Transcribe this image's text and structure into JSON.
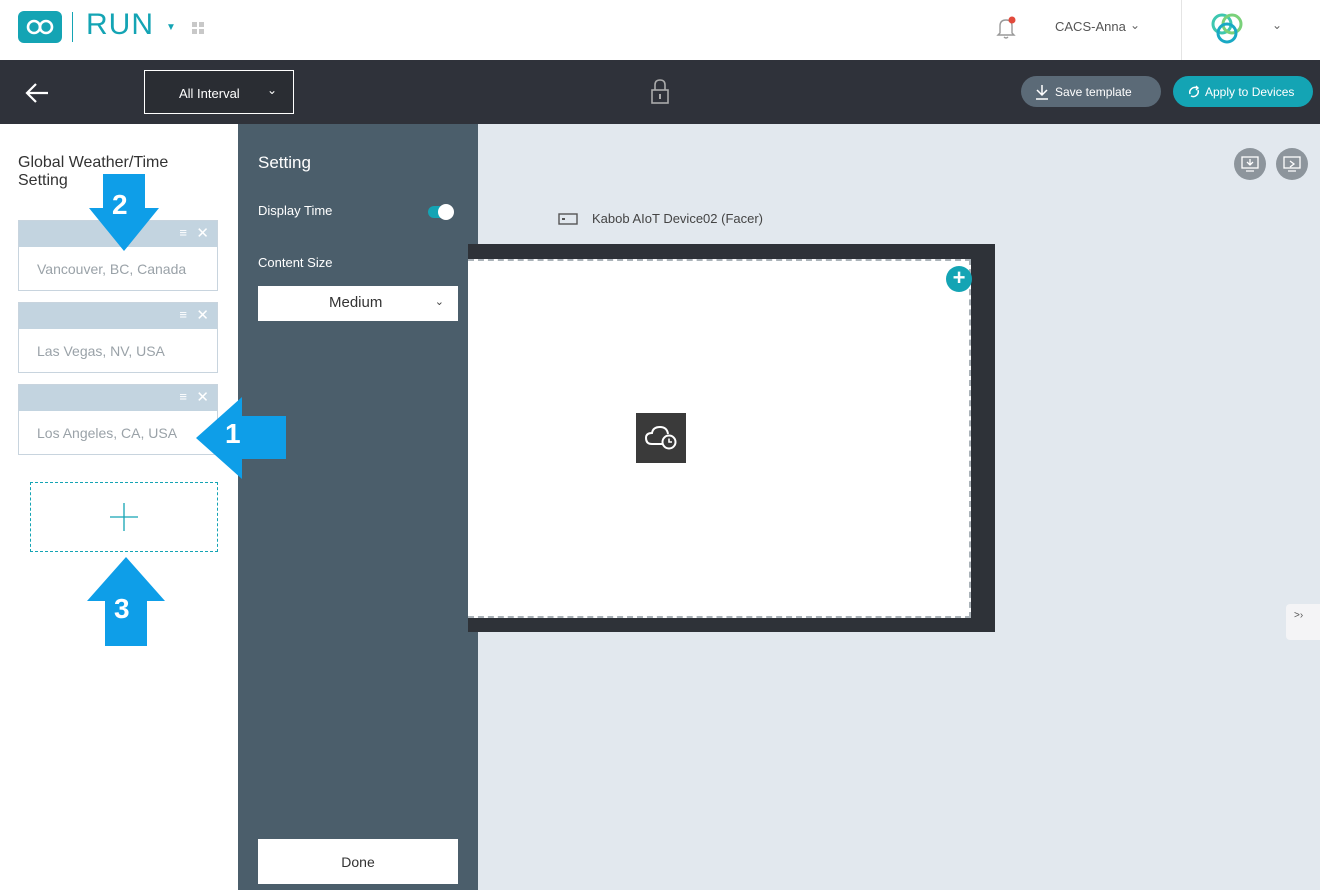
{
  "header": {
    "app_name": "RUN",
    "user_name": "CACS-Anna"
  },
  "toolbar": {
    "interval_label": "All Interval",
    "save_label": "Save template",
    "apply_label": "Apply to Devices"
  },
  "left_panel": {
    "title": "Global Weather/Time Setting",
    "locations": [
      {
        "name": "Vancouver, BC, Canada"
      },
      {
        "name": "Las Vegas, NV, USA"
      },
      {
        "name": "Los Angeles, CA, USA"
      }
    ]
  },
  "setting_panel": {
    "title": "Setting",
    "display_time_label": "Display Time",
    "display_time_on": true,
    "content_size_label": "Content Size",
    "content_size_value": "Medium",
    "done_label": "Done"
  },
  "canvas": {
    "device_name": "Kabob AIoT Device02 (Facer)"
  },
  "annotations": [
    "1",
    "2",
    "3"
  ],
  "colors": {
    "accent": "#14a4b4",
    "toolbar_bg": "#2f323a",
    "setting_bg": "#4b5e6b",
    "canvas_bg": "#e2e8ee",
    "arrow": "#0e9ee8",
    "notification_dot": "#e24a3b"
  },
  "icons": [
    "app-logo-icon",
    "apps-grid-icon",
    "bell-icon",
    "brand-icon",
    "back-arrow-icon",
    "lock-icon",
    "download-icon",
    "sync-icon",
    "drag-handle-icon",
    "close-icon",
    "plus-icon",
    "cloud-clock-icon",
    "device-icon",
    "screen-download-icon",
    "monitor-icon"
  ]
}
